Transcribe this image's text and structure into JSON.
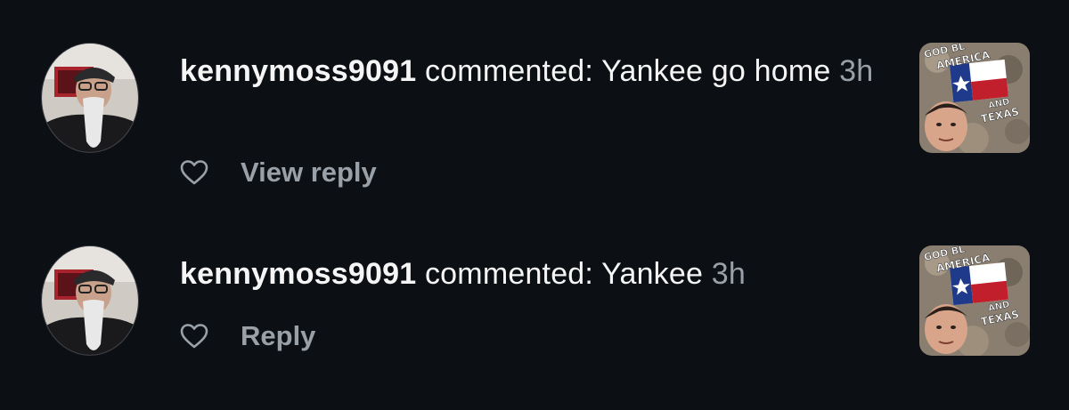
{
  "notifications": [
    {
      "username": "kennymoss9091",
      "action": "commented: Yankee go home",
      "time": "3h",
      "reply_label": "View reply",
      "like_icon": "heart-outline-icon",
      "avatar": "user-avatar",
      "thumbnail": {
        "text_lines": [
          "GOD BL",
          "AMERICA",
          "AND",
          "TEXAS"
        ]
      }
    },
    {
      "username": "kennymoss9091",
      "action": "commented: Yankee",
      "time": "3h",
      "reply_label": "Reply",
      "like_icon": "heart-outline-icon",
      "avatar": "user-avatar",
      "thumbnail": {
        "text_lines": [
          "GOD BL",
          "AMERICA",
          "AND",
          "TEXAS"
        ]
      }
    }
  ],
  "colors": {
    "background": "#0c0f14",
    "primary_text": "#f5f5f5",
    "secondary_text": "#9aa0a8"
  }
}
